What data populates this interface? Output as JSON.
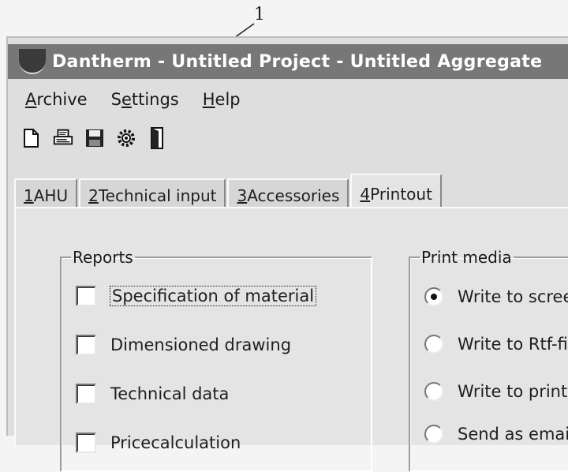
{
  "callout": {
    "number": "1"
  },
  "window": {
    "title": "Dantherm - Untitled Project - Untitled Aggregate"
  },
  "menu": {
    "archive": {
      "accel": "A",
      "rest": "rchive"
    },
    "settings": {
      "pre": "S",
      "accel": "e",
      "rest": "ttings"
    },
    "help": {
      "accel": "H",
      "rest": "elp"
    }
  },
  "toolbar": {
    "icons": [
      "new-document-icon",
      "print-preview-icon",
      "save-icon",
      "settings-gear-icon",
      "exit-door-icon"
    ]
  },
  "tabs": [
    {
      "accel": "1",
      "rest": " AHU"
    },
    {
      "accel": "2",
      "rest": " Technical input"
    },
    {
      "accel": "3",
      "rest": " Accessories"
    },
    {
      "accel": "4",
      "rest": " Printout"
    }
  ],
  "active_tab": "4 Printout",
  "reports": {
    "legend": "Reports",
    "items": [
      {
        "label": "Specification of material",
        "checked": false
      },
      {
        "label": "Dimensioned drawing",
        "checked": false
      },
      {
        "label": "Technical data",
        "checked": false
      },
      {
        "label": "Pricecalculation",
        "checked": false
      }
    ]
  },
  "print_media": {
    "legend": "Print media",
    "options": [
      {
        "label": "Write to scree",
        "selected": true
      },
      {
        "label": "Write to Rtf-fil",
        "selected": false
      },
      {
        "label": "Write to printe",
        "selected": false
      },
      {
        "label": "Send as emai",
        "selected": false
      }
    ]
  }
}
